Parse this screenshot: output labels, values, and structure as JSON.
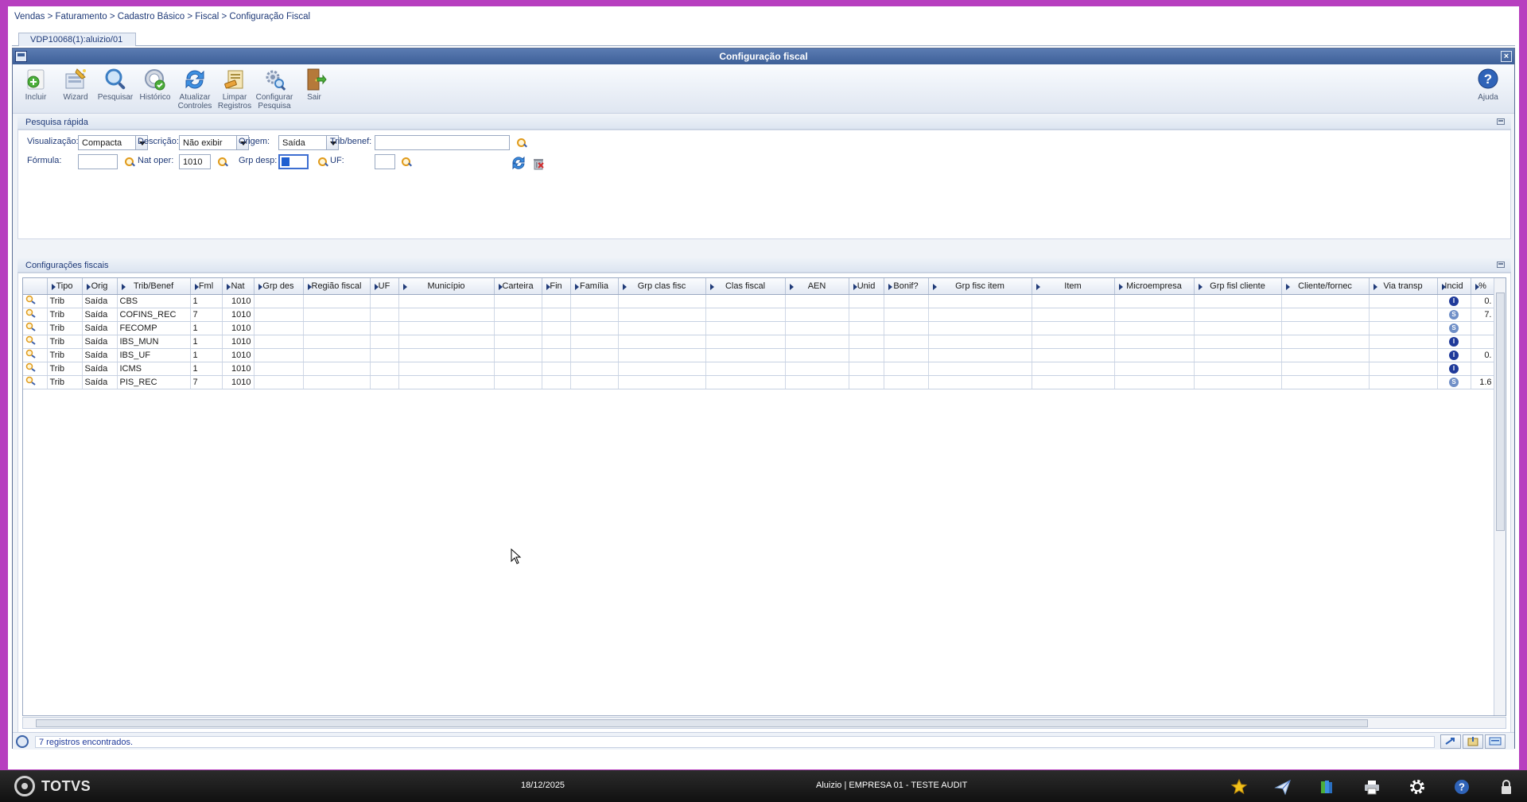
{
  "breadcrumb": [
    "Vendas",
    "Faturamento",
    "Cadastro Básico",
    "Fiscal",
    "Configuração Fiscal"
  ],
  "breadcrumb_sep": " > ",
  "tab": {
    "label": "VDP10068(1):aluizio/01"
  },
  "window": {
    "title": "Configuração fiscal",
    "close_symbol": "×"
  },
  "toolbar": {
    "incluir": "Incluir",
    "wizard": "Wizard",
    "pesquisar": "Pesquisar",
    "historico": "Histórico",
    "atualizar_1": "Atualizar",
    "atualizar_2": "Controles",
    "limpar_1": "Limpar",
    "limpar_2": "Registros",
    "configurar_1": "Configurar",
    "configurar_2": "Pesquisa",
    "sair": "Sair",
    "ajuda": "Ajuda"
  },
  "quick_search": {
    "title": "Pesquisa rápida",
    "visualizacao_label": "Visualização:",
    "visualizacao_value": "Compacta",
    "descricao_label": "Descrição:",
    "descricao_value": "Não exibir",
    "origem_label": "Origem:",
    "origem_value": "Saída",
    "trib_label": "Trib/benef:",
    "trib_value": "",
    "formula_label": "Fórmula:",
    "formula_value": "",
    "natoper_label": "Nat oper:",
    "natoper_value": "1010",
    "grpdesp_label": "Grp desp:",
    "grpdesp_value": "",
    "uf_label": "UF:",
    "uf_value": ""
  },
  "grid": {
    "title": "Configurações fiscais",
    "columns": [
      "",
      "Tipo",
      "Orig",
      "Trib/Benef",
      "Fml",
      "Nat",
      "Grp des",
      "Região fiscal",
      "UF",
      "Município",
      "Carteira",
      "Fin",
      "Família",
      "Grp clas fisc",
      "Clas fiscal",
      "AEN",
      "Unid",
      "Bonif?",
      "Grp fisc item",
      "Item",
      "Microempresa",
      "Grp fisl cliente",
      "Cliente/fornec",
      "Via transp",
      "Incid",
      "%"
    ],
    "rows": [
      {
        "tipo": "Trib",
        "orig": "Saída",
        "trib": "CBS",
        "fml": "1",
        "nat": "1010",
        "incid": "I",
        "pct": "0."
      },
      {
        "tipo": "Trib",
        "orig": "Saída",
        "trib": "COFINS_REC",
        "fml": "7",
        "nat": "1010",
        "incid": "S",
        "pct": "7."
      },
      {
        "tipo": "Trib",
        "orig": "Saída",
        "trib": "FECOMP",
        "fml": "1",
        "nat": "1010",
        "incid": "S",
        "pct": ""
      },
      {
        "tipo": "Trib",
        "orig": "Saída",
        "trib": "IBS_MUN",
        "fml": "1",
        "nat": "1010",
        "incid": "I",
        "pct": ""
      },
      {
        "tipo": "Trib",
        "orig": "Saída",
        "trib": "IBS_UF",
        "fml": "1",
        "nat": "1010",
        "incid": "I",
        "pct": "0."
      },
      {
        "tipo": "Trib",
        "orig": "Saída",
        "trib": "ICMS",
        "fml": "1",
        "nat": "1010",
        "incid": "I",
        "pct": ""
      },
      {
        "tipo": "Trib",
        "orig": "Saída",
        "trib": "PIS_REC",
        "fml": "7",
        "nat": "1010",
        "incid": "S",
        "pct": "1.6"
      }
    ]
  },
  "status": {
    "message": "7 registros encontrados."
  },
  "taskbar": {
    "brand": "TOTVS",
    "date": "18/12/2025",
    "user": "Aluizio | EMPRESA 01 - TESTE AUDIT"
  },
  "colors": {
    "accent": "#3d5f98",
    "frame": "#b73fbf",
    "link": "#1f3a78"
  }
}
